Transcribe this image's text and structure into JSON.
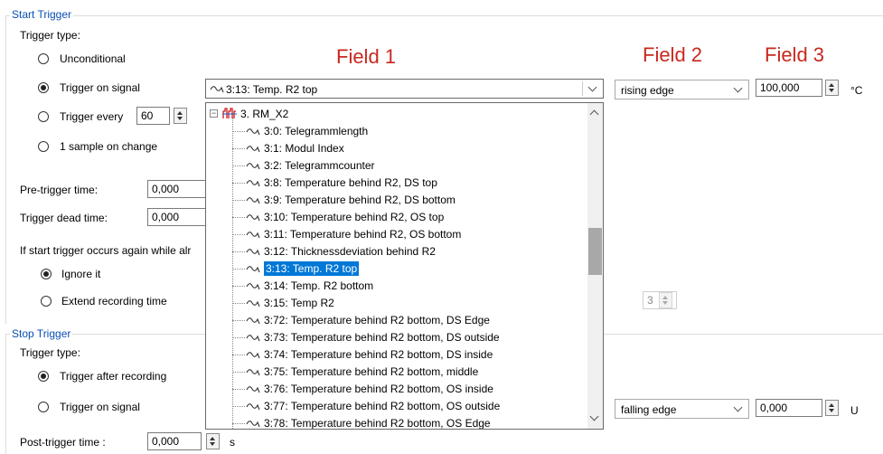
{
  "start_trigger": {
    "title": "Start Trigger",
    "trigger_type_label": "Trigger type:",
    "options": {
      "unconditional": "Unconditional",
      "on_signal": "Trigger on signal",
      "every": "Trigger every",
      "every_value": "60",
      "sample_change": "1 sample on change"
    },
    "pre_trigger_label": "Pre-trigger time:",
    "pre_trigger_value": "0,000",
    "dead_time_label": "Trigger dead time:",
    "dead_time_value": "0,000",
    "again_label": "If start trigger occurs again while alr",
    "again_options": {
      "ignore": "Ignore it",
      "extend": "Extend recording time"
    },
    "extend_value": "3"
  },
  "fields": {
    "field1_label": "Field 1",
    "field2_label": "Field 2",
    "field3_label": "Field 3",
    "signal_value": "3:13: Temp. R2 top",
    "edge_value": "rising edge",
    "threshold_value": "100,000",
    "unit": "°C"
  },
  "signal_list": {
    "group": "3. RM_X2",
    "items": [
      "3:0: Telegrammlength",
      "3:1: Modul Index",
      "3:2: Telegrammcounter",
      "3:8: Temperature behind R2, DS top",
      "3:9: Temperature behind R2, DS bottom",
      "3:10: Temperature behind R2, OS top",
      "3:11: Temperature behind R2, OS bottom",
      "3:12: Thicknessdeviation behind R2",
      "3:13: Temp. R2 top",
      "3:14: Temp. R2 bottom",
      "3:15: Temp R2",
      "3:72: Temperature behind R2 bottom, DS Edge",
      "3:73: Temperature behind R2 bottom, DS outside",
      "3:74: Temperature behind R2 bottom, DS inside",
      "3:75: Temperature behind R2 bottom, middle",
      "3:76: Temperature behind R2 bottom, OS inside",
      "3:77: Temperature behind R2 bottom, OS outside",
      "3:78: Temperature behind R2 bottom, OS Edge"
    ],
    "selected_index": 8
  },
  "stop_trigger": {
    "title": "Stop Trigger",
    "trigger_type_label": "Trigger type:",
    "options": {
      "after": "Trigger after recording",
      "on_signal": "Trigger on signal"
    },
    "edge_value": "falling edge",
    "threshold_value": "0,000",
    "unit": "U",
    "post_label": "Post-trigger time :",
    "post_value": "0,000",
    "post_unit": "s"
  }
}
